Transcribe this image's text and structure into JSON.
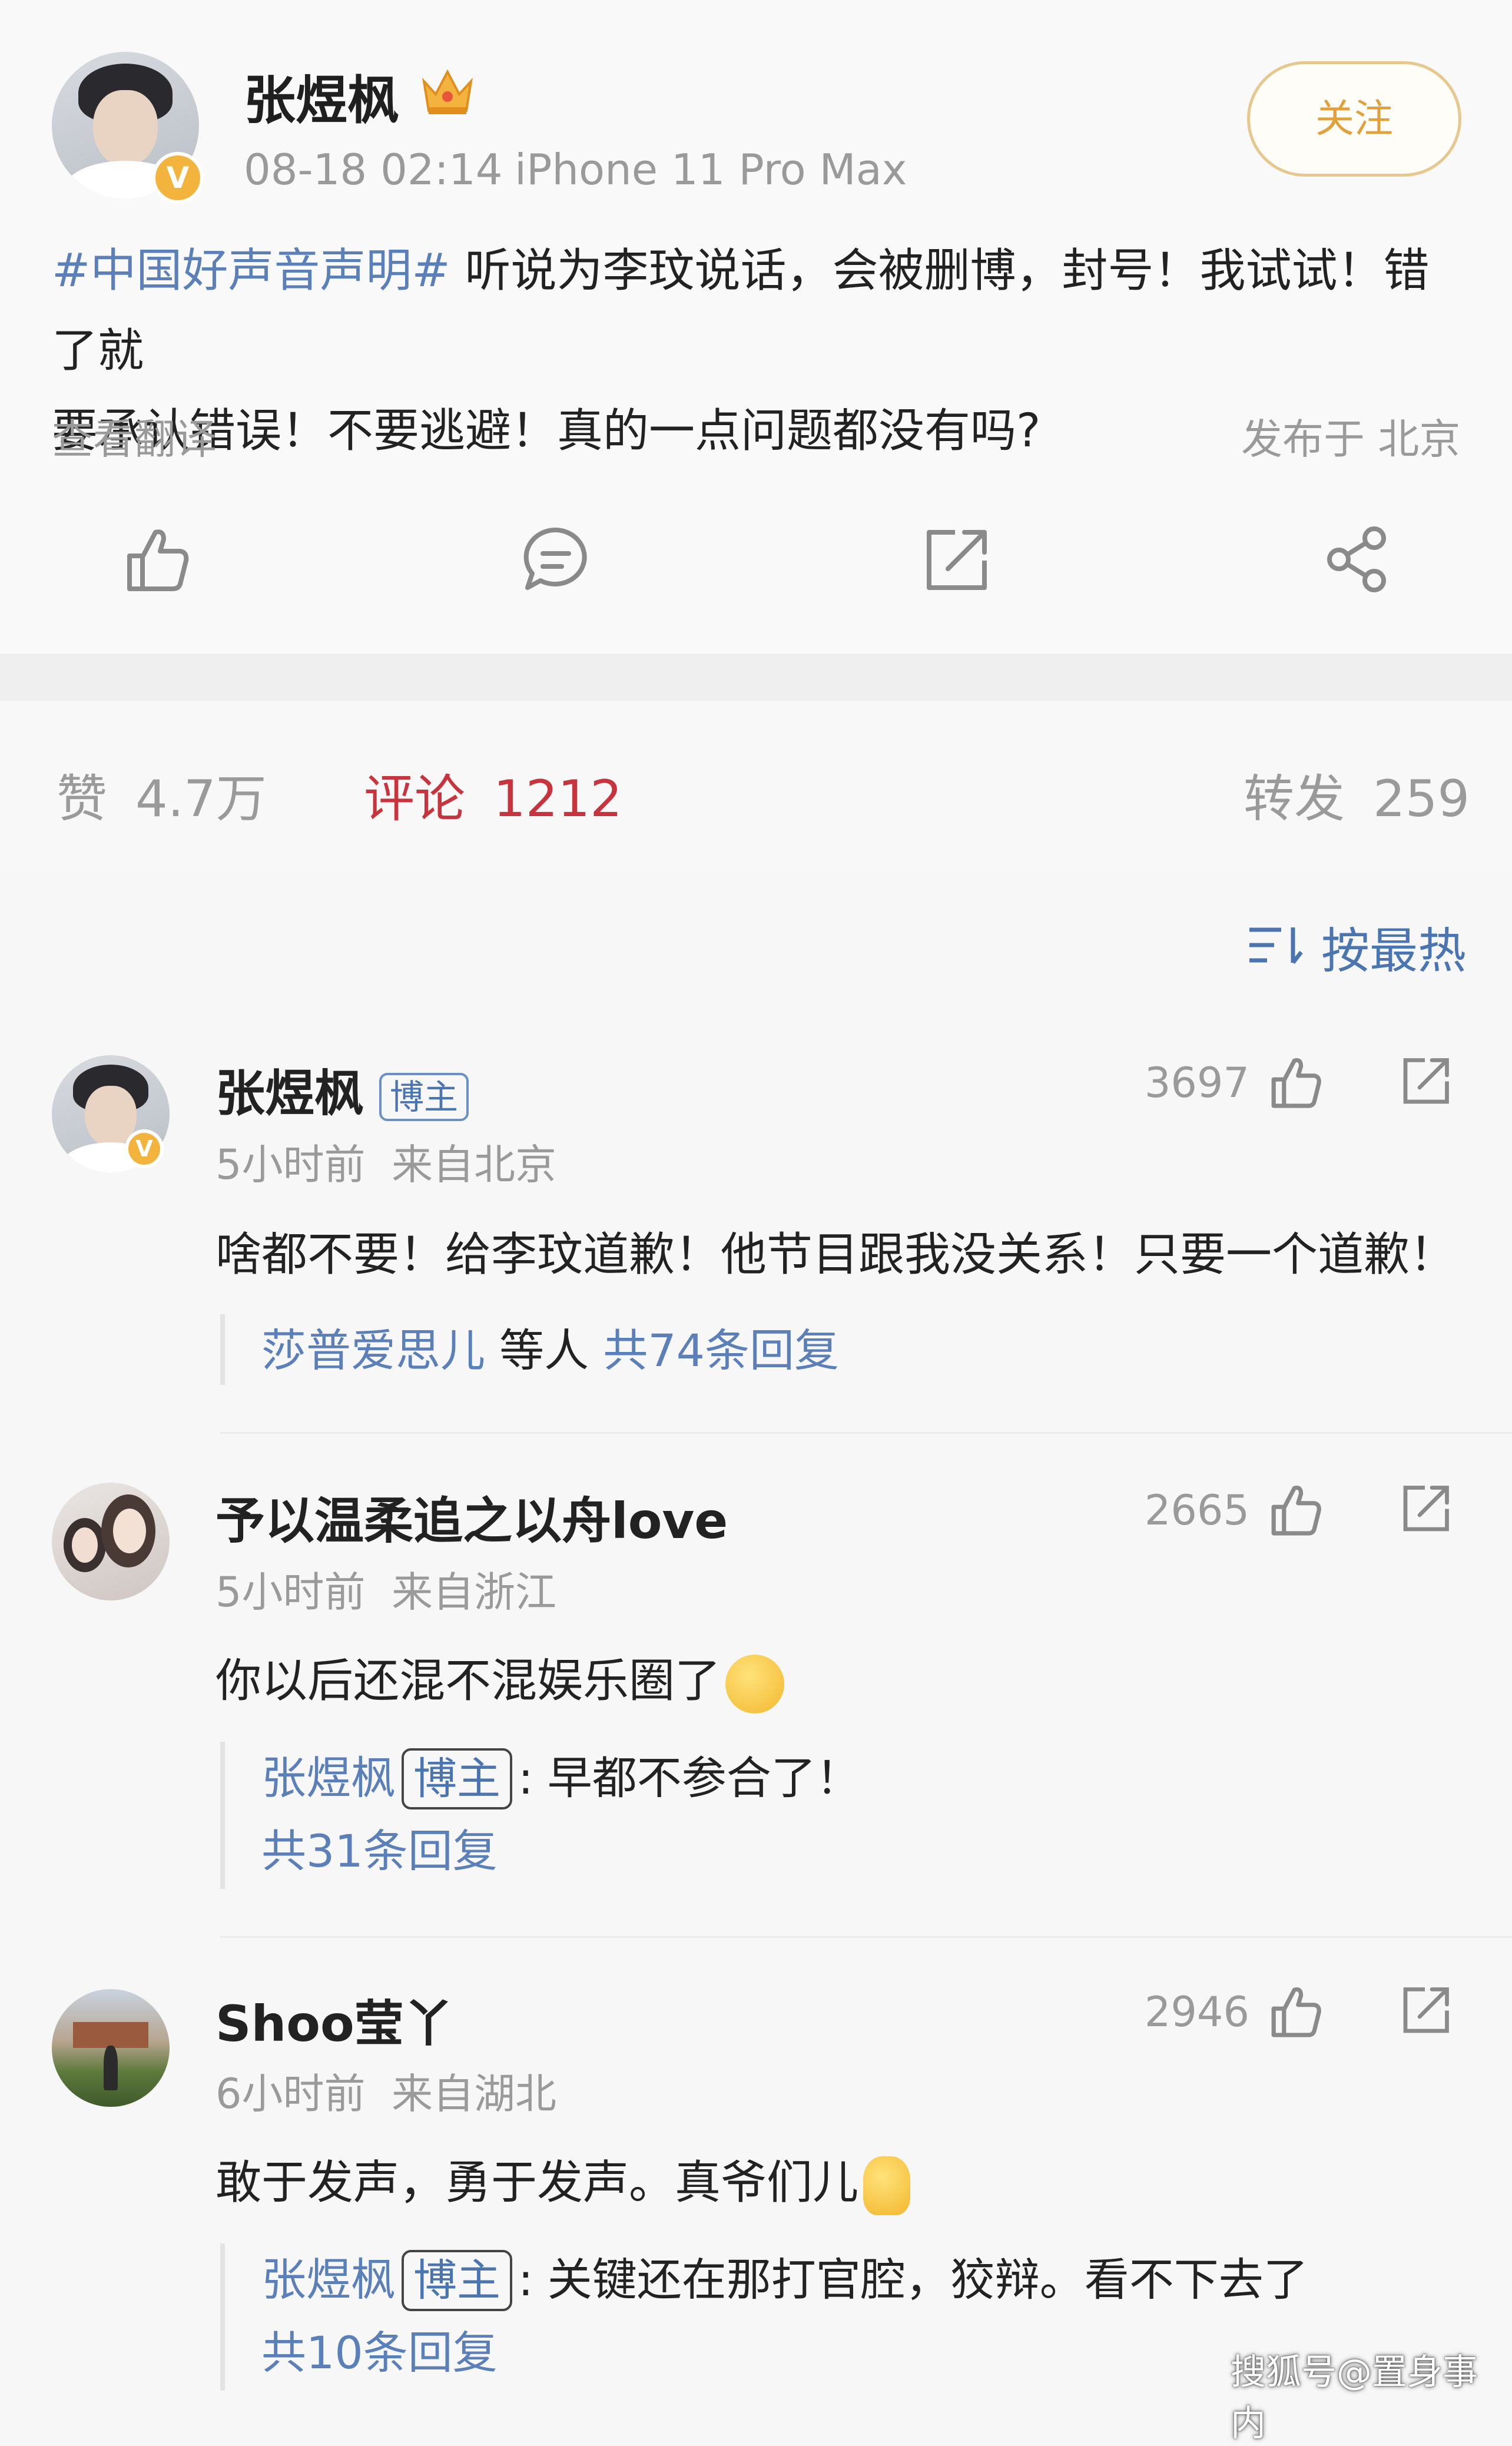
{
  "post": {
    "author": "张煜枫",
    "time": "08-18 02:14",
    "device": "iPhone 11 Pro Max",
    "follow_label": "关注",
    "hashtag": "#中国好声音声明#",
    "text_line1": " 听说为李玟说话，会被删博，封号！我试试！错了就",
    "text_line2": "要承认错误！不要逃避！真的一点问题都没有吗?",
    "translate_label": "查看翻译",
    "location": "发布于 北京",
    "actions": [
      "like-icon",
      "comment-icon",
      "repost-icon",
      "share-icon"
    ]
  },
  "stats": {
    "like_label": "赞",
    "like_count": "4.7万",
    "comment_label": "评论",
    "comment_count": "1212",
    "repost_label": "转发",
    "repost_count": "259"
  },
  "sort_label": "按最热",
  "comments": [
    {
      "name": "张煜枫",
      "tag": "博主",
      "time": "5小时前",
      "from": "来自北京",
      "likes": "3697",
      "text": "啥都不要！给李玟道歉！他节目跟我没关系！只要一个道歉！",
      "reply_user": "莎普爱思儿",
      "reply_mid": " 等人 ",
      "reply_count": "共74条回复"
    },
    {
      "name": "予以温柔追之以舟love",
      "time": "5小时前",
      "from": "来自浙江",
      "likes": "2665",
      "text": "你以后还混不混娱乐圈了",
      "reply_user": "张煜枫",
      "reply_tag": "博主",
      "reply_text": ": 早都不参合了！",
      "reply_count": "共31条回复"
    },
    {
      "name": "Shoo莹丫",
      "time": "6小时前",
      "from": "来自湖北",
      "likes": "2946",
      "text": "敢于发声，勇于发声。真爷们儿",
      "reply_user": "张煜枫",
      "reply_tag": "博主",
      "reply_text": ": 关键还在那打官腔，狡辩。看不下去了",
      "reply_count": "共10条回复"
    }
  ],
  "watermark": "搜狐号@置身事内",
  "colors": {
    "accent_red": "#c8343d",
    "link_blue": "#4a75b0",
    "follow_gold": "#e2a03a"
  }
}
